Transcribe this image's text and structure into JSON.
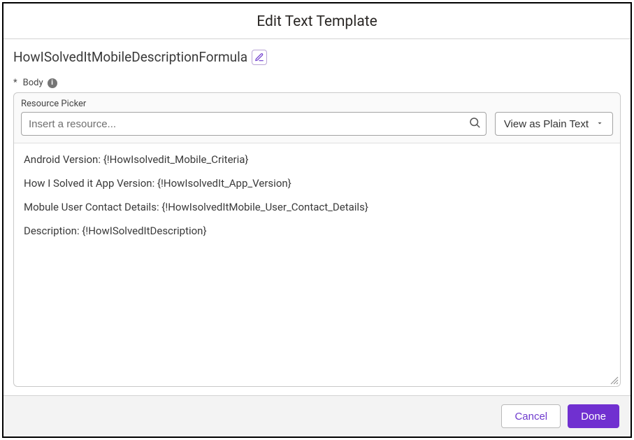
{
  "modal": {
    "title": "Edit Text Template",
    "template_name": "HowISolvedItMobileDescriptionFormula",
    "body_label": "Body",
    "resource_picker_label": "Resource Picker",
    "resource_picker_placeholder": "Insert a resource...",
    "view_mode_label": "View as Plain Text",
    "body_lines": [
      "Android Version: {!HowIsolvedit_Mobile_Criteria}",
      "How I Solved it App Version: {!HowIsolvedIt_App_Version}",
      "Mobule User Contact Details: {!HowIsolvedItMobile_User_Contact_Details}",
      "Description: {!HowISolvedItDescription}"
    ]
  },
  "footer": {
    "cancel": "Cancel",
    "done": "Done"
  },
  "icons": {
    "edit": "pencil-icon",
    "info": "info-icon",
    "search": "search-icon",
    "dropdown": "chevron-down-icon",
    "resize": "resize-handle-icon"
  },
  "colors": {
    "accent": "#7030d0",
    "border": "#c9c9c9",
    "panel_bg": "#fafafa",
    "footer_bg": "#f3f3f3"
  }
}
